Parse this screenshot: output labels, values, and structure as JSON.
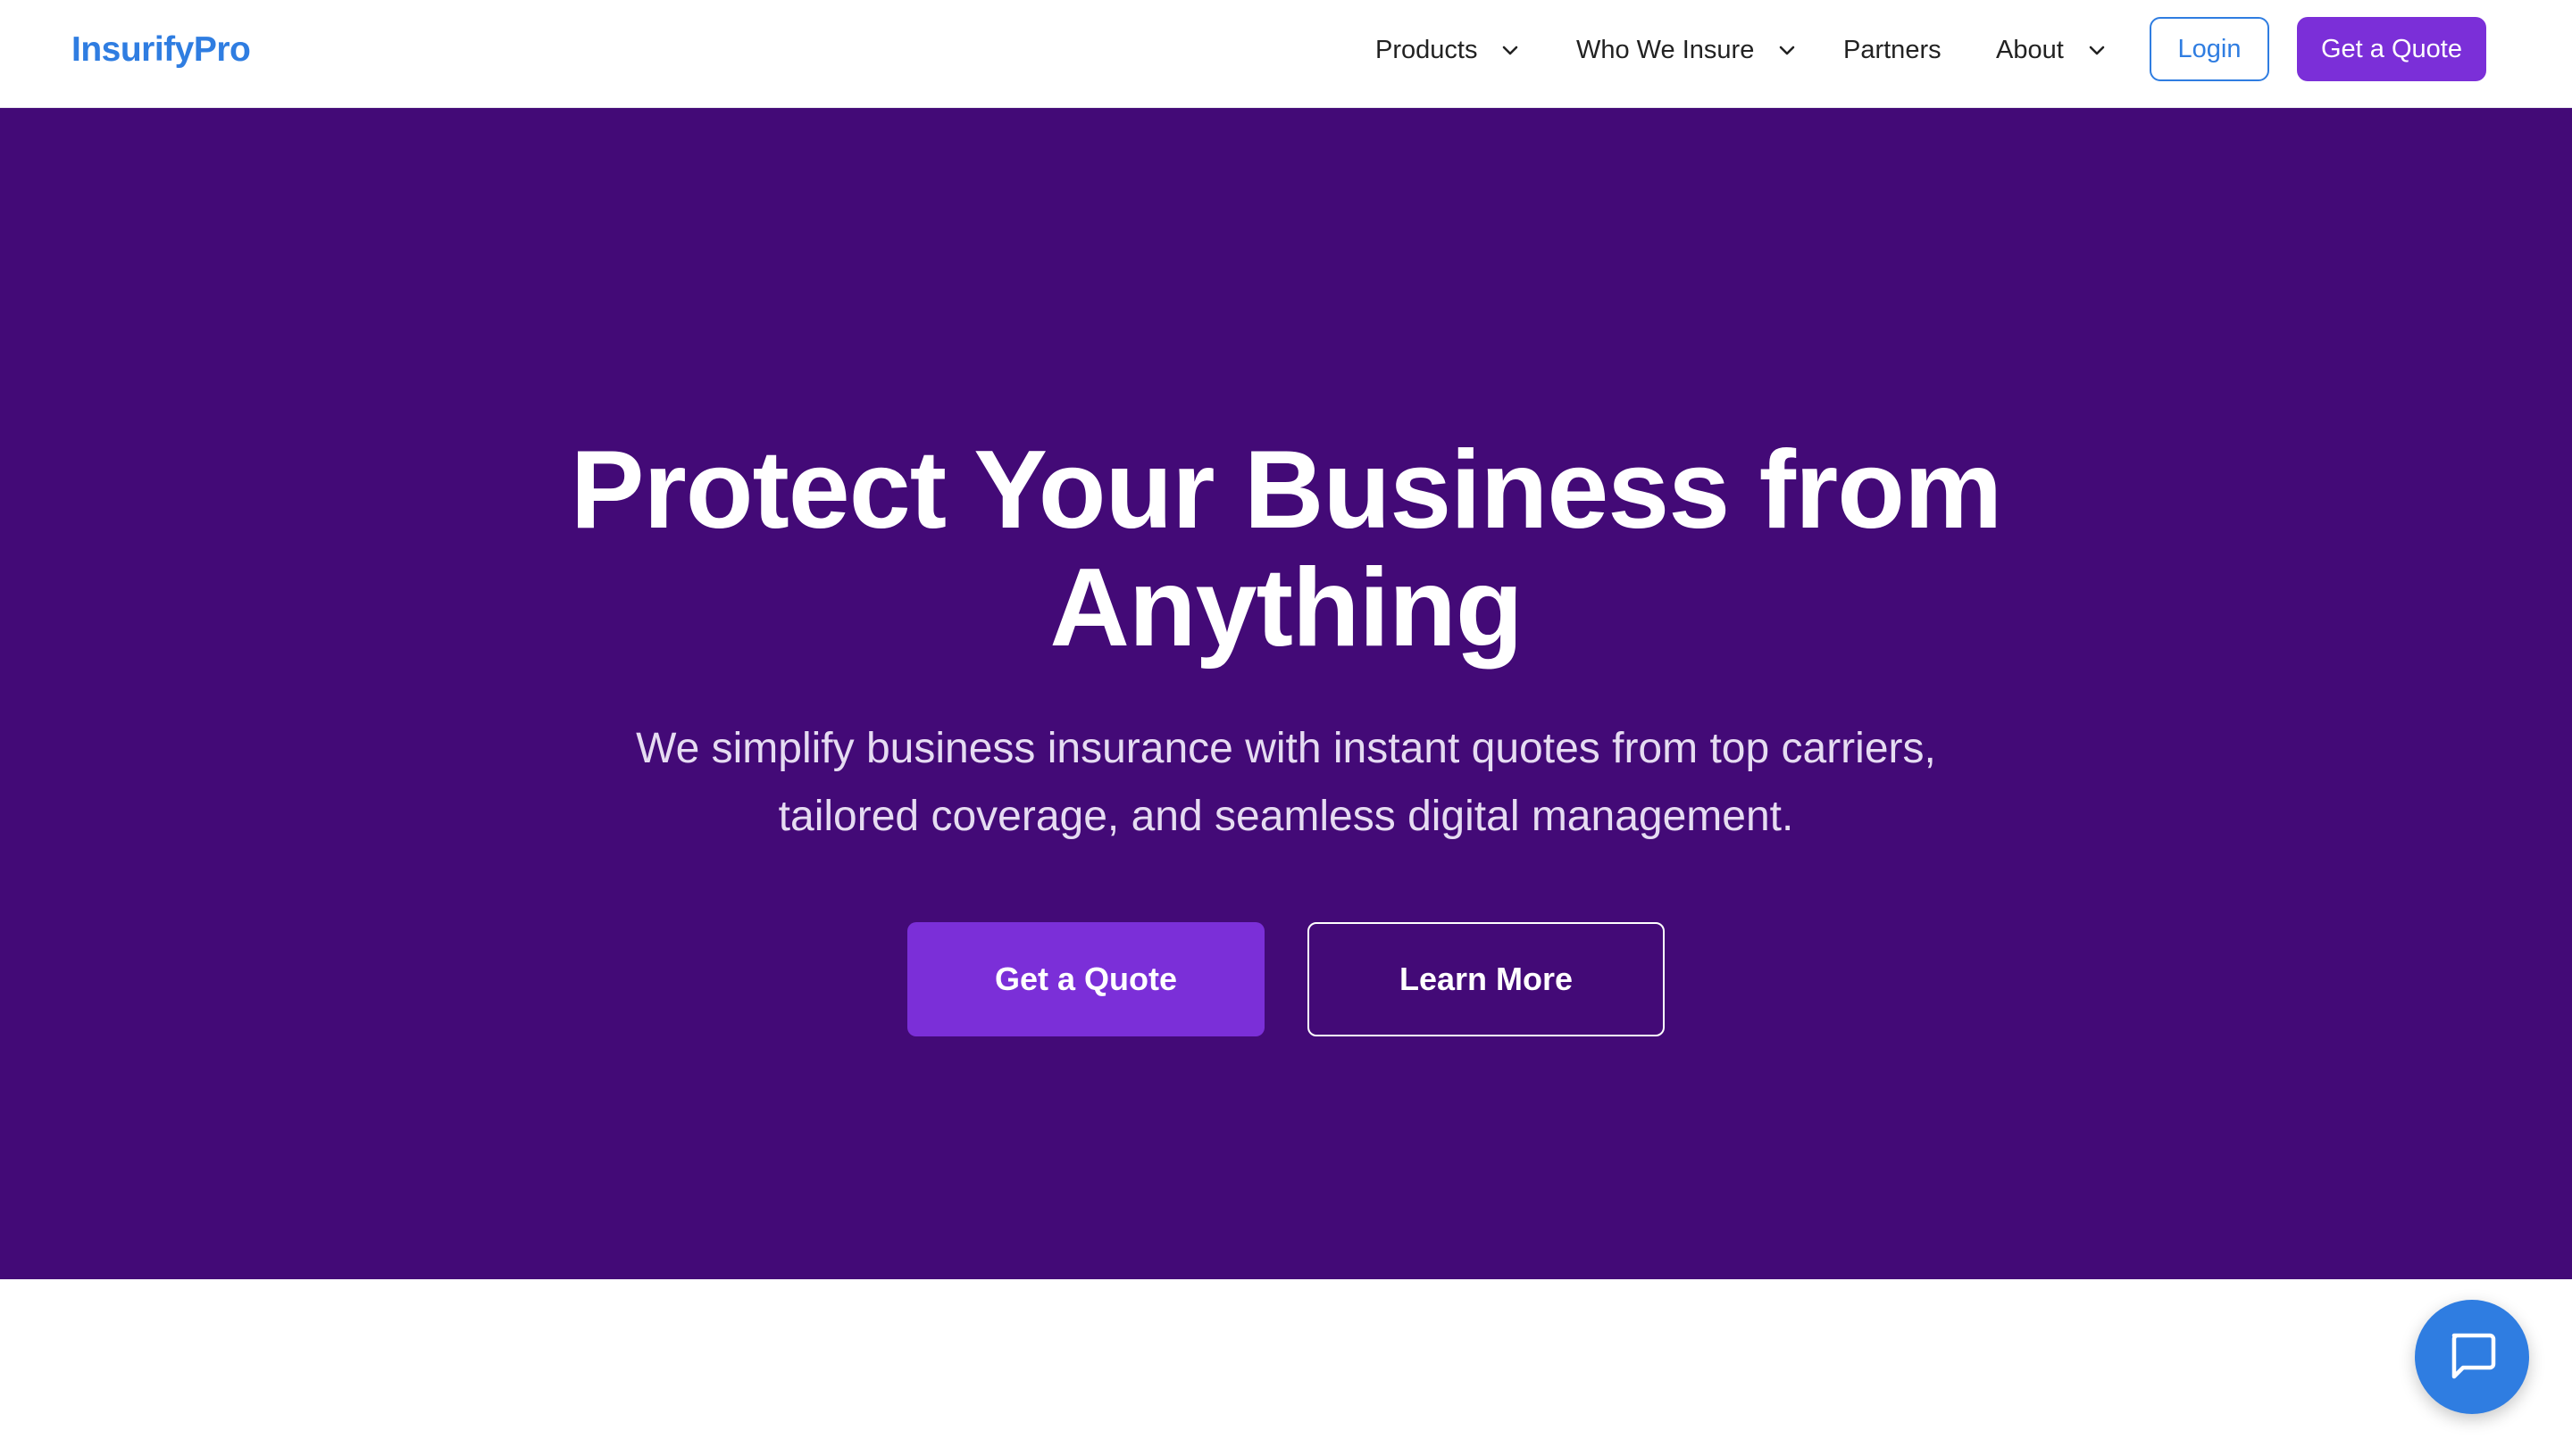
{
  "navbar": {
    "logo": "InsurifyPro",
    "items": [
      {
        "label": "Products",
        "has_dropdown": true,
        "icon": "chevron-down-icon"
      },
      {
        "label": "Who We Insure",
        "has_dropdown": true,
        "icon": "chevron-down-icon"
      },
      {
        "label": "Partners",
        "has_dropdown": false
      },
      {
        "label": "About",
        "has_dropdown": true,
        "icon": "chevron-down-icon"
      }
    ],
    "login_label": "Login",
    "quote_label": "Get a Quote"
  },
  "hero": {
    "title": "Protect Your Business from Anything",
    "subtitle": "We simplify business insurance with instant quotes from top carriers, tailored coverage, and seamless digital management.",
    "primary_cta": "Get a Quote",
    "secondary_cta": "Learn More"
  },
  "chat": {
    "icon": "chat-bubble-icon"
  },
  "colors": {
    "brand_blue": "#2f7de1",
    "hero_purple": "#430a77",
    "accent_purple": "#7b2fd8",
    "white": "#ffffff"
  }
}
